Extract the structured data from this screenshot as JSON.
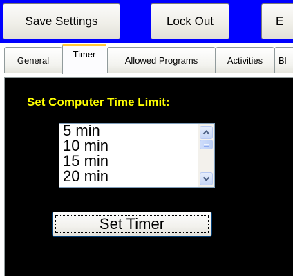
{
  "toolbar": {
    "save_label": "Save Settings",
    "lockout_label": "Lock Out",
    "third_label": "E"
  },
  "tabs": [
    {
      "label": "General"
    },
    {
      "label": "Timer"
    },
    {
      "label": "Allowed Programs"
    },
    {
      "label": "Activities"
    },
    {
      "label": "Bl"
    }
  ],
  "active_tab": "Timer",
  "timer": {
    "heading": "Set Computer Time Limit:",
    "options": [
      "5 min",
      "10 min",
      "15 min",
      "20 min"
    ],
    "set_button_label": "Set Timer"
  },
  "colors": {
    "toolbar_bg": "#0000ff",
    "panel_bg": "#000000",
    "heading": "#ffff00",
    "active_tab_accent": "#ffc83c"
  }
}
